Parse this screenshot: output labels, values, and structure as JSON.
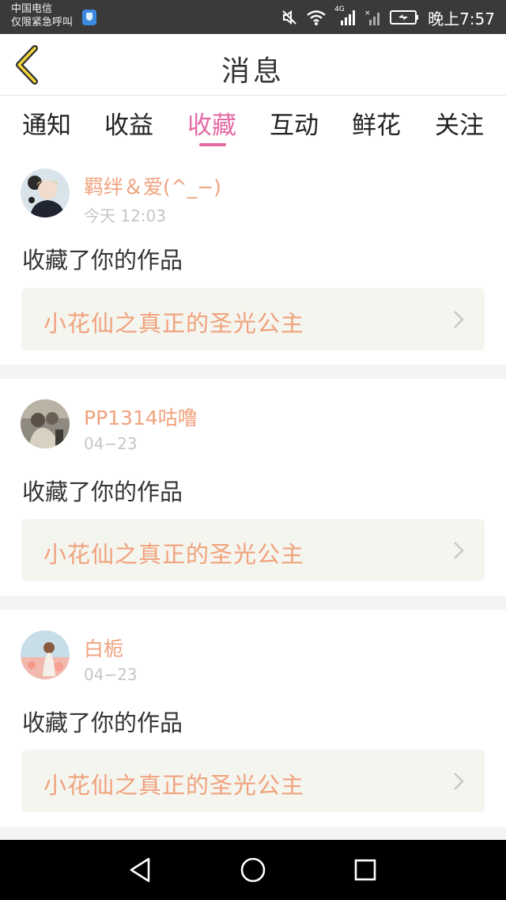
{
  "status_bar": {
    "carrier_line1": "中国电信",
    "carrier_line2": "仅限紧急呼叫",
    "network": "4G",
    "time": "晚上7:57"
  },
  "header": {
    "title": "消息",
    "back_icon": "chevron-left-icon"
  },
  "tabs": [
    {
      "label": "通知",
      "active": false
    },
    {
      "label": "收益",
      "active": false
    },
    {
      "label": "收藏",
      "active": true
    },
    {
      "label": "互动",
      "active": false
    },
    {
      "label": "鲜花",
      "active": false
    },
    {
      "label": "关注",
      "active": false
    }
  ],
  "colors": {
    "accent": "#e46aa5",
    "name_orange": "#f0a27d",
    "card_bg": "#f5f5ef"
  },
  "messages": [
    {
      "user": "羁绊＆爱(^_−)",
      "time": "今天 12:03",
      "action": "收藏了你的作品",
      "work_title": "小花仙之真正的圣光公主"
    },
    {
      "user": "PP1314咕噜",
      "time": "04−23",
      "action": "收藏了你的作品",
      "work_title": "小花仙之真正的圣光公主"
    },
    {
      "user": "白栀",
      "time": "04−23",
      "action": "收藏了你的作品",
      "work_title": "小花仙之真正的圣光公主"
    }
  ],
  "nav_bar": {
    "back_icon": "triangle-back-icon",
    "home_icon": "circle-home-icon",
    "recent_icon": "square-recents-icon"
  }
}
